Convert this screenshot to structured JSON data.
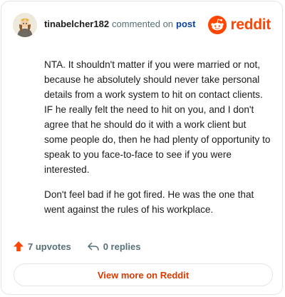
{
  "comment": {
    "username": "tinabelcher182",
    "action_text": "commented on",
    "target_text": "post",
    "paragraphs": [
      "NTA. It shouldn't matter if you were married or not, because he absolutely should never take personal details from a work system to hit on contact clients. IF he really felt the need to hit on you, and I don't agree that he should do it with a work client but some people do, then he had plenty of opportunity to speak to you face-to-face to see if you were interested.",
      "Don't feel bad if he got fired. He was the one that went against the rules of his workplace."
    ]
  },
  "brand": {
    "name": "reddit",
    "logo_icon": "reddit-snoo-icon",
    "color": "#ff4500"
  },
  "footer": {
    "upvotes_label": "7 upvotes",
    "upvote_icon": "upvote-arrow-icon",
    "upvote_color": "#ff4500",
    "replies_label": "0 replies",
    "reply_icon": "reply-arrow-icon"
  },
  "view_more_label": "View more on Reddit"
}
